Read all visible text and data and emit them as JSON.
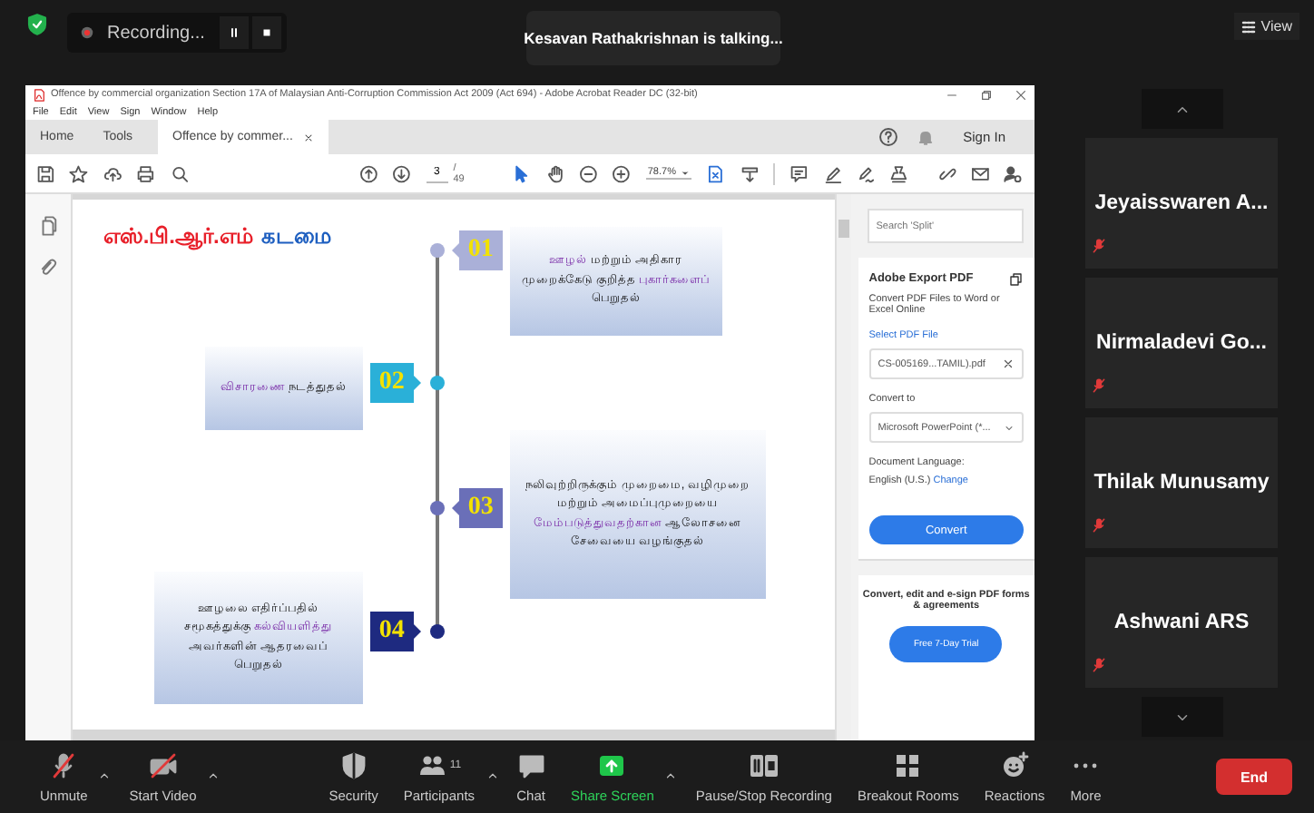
{
  "top_bar": {
    "recording_label": "Recording...",
    "talking_indicator": "Kesavan Rathakrishnan is talking...",
    "view_button": "View"
  },
  "acrobat": {
    "title": "Offence by commercial organization Section 17A of Malaysian Anti-Corruption Commission Act 2009 (Act 694) - Adobe Acrobat Reader DC (32-bit)",
    "menu": [
      "File",
      "Edit",
      "View",
      "Sign",
      "Window",
      "Help"
    ],
    "tabs": [
      {
        "label": "Home",
        "selected": false
      },
      {
        "label": "Tools",
        "selected": false
      },
      {
        "label": "Offence by commer...",
        "selected": true
      }
    ],
    "sign_in": "Sign In",
    "page_current": "3",
    "page_total": "/ 49",
    "zoom": "78.7%",
    "slide": {
      "title": [
        {
          "text": "எஸ்.பி.ஆர்.எம்",
          "kind": "primary"
        },
        {
          "text": "கடமை",
          "kind": "secondary"
        }
      ],
      "steps": [
        {
          "number": "01",
          "color": "#aab0d8",
          "segments": [
            {
              "text": "ஊழல்",
              "highlight": true
            },
            {
              "text": " மற்றும் அதிகார முறைக்கேடு குறித்த ",
              "highlight": false
            },
            {
              "text": "புகார்களைப்",
              "highlight": true
            },
            {
              "text": " பெறுதல்",
              "highlight": false
            }
          ]
        },
        {
          "number": "02",
          "color": "#2ab0d8",
          "segments": [
            {
              "text": "விசாரணை",
              "highlight": true
            },
            {
              "text": " நடத்துதல்",
              "highlight": false
            }
          ]
        },
        {
          "number": "03",
          "color": "#6a6fb8",
          "segments": [
            {
              "text": "நலிவுற்றிருக்கும் முறைமை, வழிமுறை மற்றும் அமைப்புமுறையை ",
              "highlight": false
            },
            {
              "text": "மேம்படுத்துவதற்கான",
              "highlight": true
            },
            {
              "text": " ஆலோசனை சேவையை வழங்குதல்",
              "highlight": false
            }
          ]
        },
        {
          "number": "04",
          "color": "#1e2a80",
          "segments": [
            {
              "text": "ஊழலை எதிர்ப்பதில் சமூகத்துக்கு ",
              "highlight": false
            },
            {
              "text": "கல்வியளித்து",
              "highlight": true
            },
            {
              "text": " அவர்களின் ஆதரவைப் பெறுதல்",
              "highlight": false
            }
          ]
        }
      ]
    },
    "side_panel": {
      "search_placeholder": "Search 'Split'",
      "export_title": "Adobe Export PDF",
      "export_description": "Convert PDF Files to Word or Excel Online",
      "select_label": "Select PDF File",
      "file": "CS-005169...TAMIL).pdf",
      "convert_to_label": "Convert to",
      "convert_to": "Microsoft PowerPoint (*...",
      "language_label": "Document Language:",
      "language": "English (U.S.)",
      "change_link": "Change",
      "convert_button": "Convert",
      "promo": "Convert, edit and e-sign PDF forms & agreements",
      "trial_button": "Free 7-Day Trial"
    }
  },
  "participants": [
    {
      "name": "Jeyaisswaren  A...",
      "muted": true
    },
    {
      "name": "Nirmaladevi  Go...",
      "muted": true
    },
    {
      "name": "Thilak Munusamy",
      "muted": true
    },
    {
      "name": "Ashwani ARS",
      "muted": true
    }
  ],
  "toolbar": [
    {
      "label": "Unmute",
      "kind": "microphone",
      "menu": true
    },
    {
      "label": "Start Video",
      "kind": "camera",
      "menu": true
    },
    {
      "label": "Security",
      "kind": "shield",
      "menu": false
    },
    {
      "label": "Participants",
      "kind": "people",
      "count": "11",
      "menu": true
    },
    {
      "label": "Chat",
      "kind": "chat",
      "menu": false
    },
    {
      "label": "Share Screen",
      "kind": "share",
      "menu": true
    },
    {
      "label": "Pause/Stop Recording",
      "kind": "recording",
      "menu": false
    },
    {
      "label": "Breakout Rooms",
      "kind": "rooms",
      "menu": false
    },
    {
      "label": "Reactions",
      "kind": "reactions",
      "menu": false
    },
    {
      "label": "More",
      "kind": "more",
      "menu": false
    }
  ],
  "end_button": "End"
}
